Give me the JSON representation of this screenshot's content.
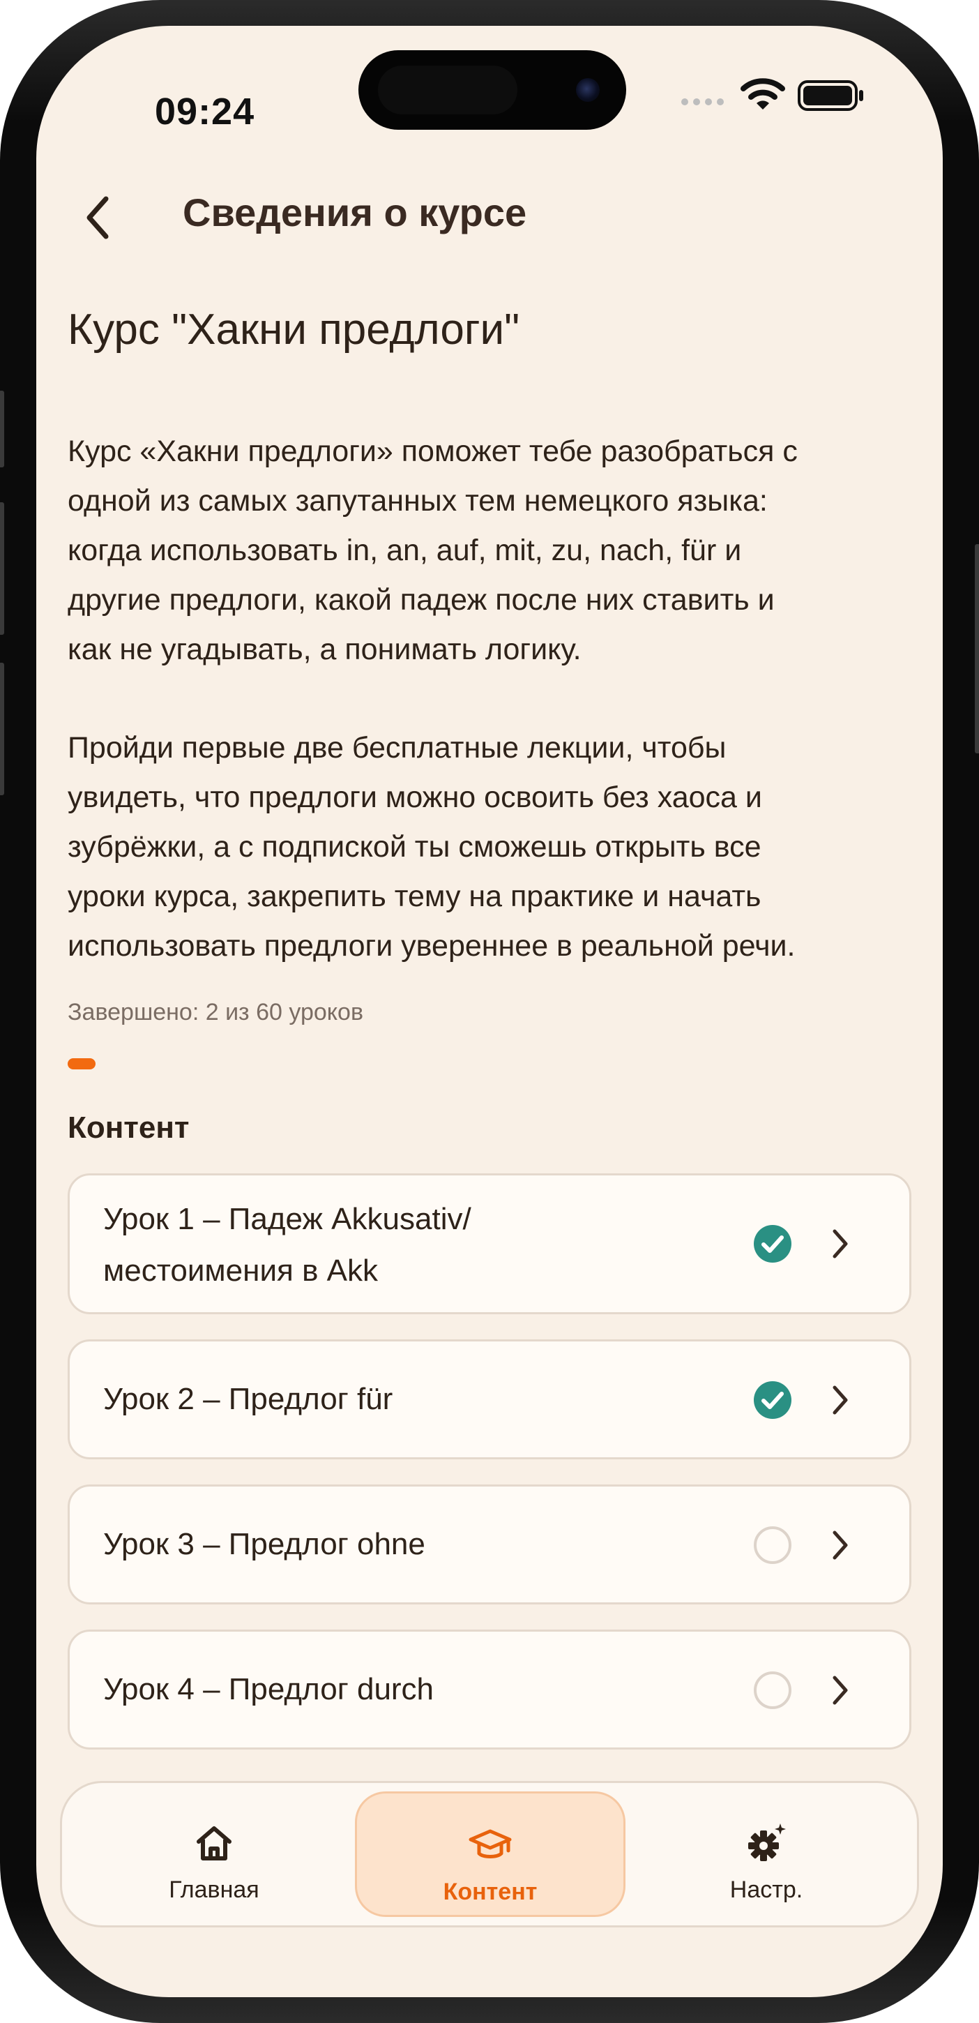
{
  "status_bar": {
    "time": "09:24"
  },
  "header": {
    "title": "Сведения о курсе"
  },
  "course": {
    "title": "Курс \"Хакни предлоги\"",
    "description_1": [
      "Курс «Хакни предлоги» поможет тебе разобраться с",
      "одной из самых запутанных тем немецкого языка:",
      "когда использовать in, an, auf, mit, zu, nach, für и",
      "другие предлоги, какой падеж после них ставить и",
      "как не угадывать, а понимать логику."
    ],
    "description_2": [
      "Пройди первые две бесплатные лекции, чтобы",
      "увидеть, что предлоги можно освоить без хаоса и",
      "зубрёжки, а с подпиской ты сможешь открыть все",
      "уроки курса, закрепить тему на практике и начать",
      "использовать предлоги увереннее в реальной речи."
    ],
    "progress_label": "Завершено: 2 из 60 уроков",
    "progress_fraction": 0.0333,
    "accent_color": "#f26a10"
  },
  "content": {
    "title": "Контент",
    "lessons": [
      {
        "label_line1": "Урок 1 – Падеж Akkusativ/",
        "label_line2": "местоимения в Akk",
        "completed": true
      },
      {
        "label_line1": "Урок 2 – Предлог für",
        "completed": true
      },
      {
        "label_line1": "Урок 3 – Предлог ohne",
        "completed": false
      },
      {
        "label_line1": "Урок 4 – Предлог durch",
        "completed": false
      }
    ]
  },
  "tabbar": {
    "items": [
      {
        "label": "Главная",
        "icon": "home-icon",
        "active": false
      },
      {
        "label": "Контент",
        "icon": "graduation-cap-icon",
        "active": true
      },
      {
        "label": "Настр.",
        "icon": "gear-sparkle-icon",
        "active": false
      }
    ]
  },
  "colors": {
    "check": "#2a9083",
    "background": "#f9f0e6",
    "active_tab": "#e8620c"
  }
}
